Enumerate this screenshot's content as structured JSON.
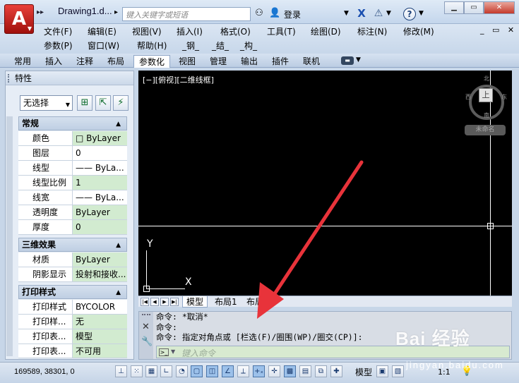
{
  "titlebar": {
    "app_logo": "A",
    "document_title": "Drawing1.d...",
    "search_placeholder": "键入关键字或短语",
    "login_label": "登录",
    "icons": [
      "binoculars-icon",
      "user-icon",
      "exchange-x-icon",
      "a360-icon",
      "help-icon"
    ]
  },
  "menu": {
    "row1": [
      "文件(F)",
      "编辑(E)",
      "视图(V)",
      "插入(I)",
      "格式(O)",
      "工具(T)",
      "绘图(D)",
      "标注(N)",
      "修改(M)"
    ],
    "row2": [
      "参数(P)",
      "窗口(W)",
      "帮助(H)",
      "_钢_",
      "_结_",
      "_构_"
    ]
  },
  "ribbon": {
    "tabs": [
      "常用",
      "插入",
      "注释",
      "布局",
      "参数化",
      "视图",
      "管理",
      "输出",
      "插件",
      "联机"
    ],
    "active_tab": "参数化"
  },
  "properties": {
    "title": "特性",
    "selection": "无选择",
    "sections": [
      {
        "title": "常规",
        "rows": [
          [
            "颜色",
            "□ ByLayer"
          ],
          [
            "图层",
            "0"
          ],
          [
            "线型",
            "—— ByLa..."
          ],
          [
            "线型比例",
            "1"
          ],
          [
            "线宽",
            "—— ByLa..."
          ],
          [
            "透明度",
            "ByLayer"
          ],
          [
            "厚度",
            "0"
          ]
        ]
      },
      {
        "title": "三维效果",
        "rows": [
          [
            "材质",
            "ByLayer"
          ],
          [
            "阴影显示",
            "投射和接收..."
          ]
        ]
      },
      {
        "title": "打印样式",
        "rows": [
          [
            "打印样式",
            "BYCOLOR"
          ],
          [
            "打印样...",
            "无"
          ],
          [
            "打印表...",
            "模型"
          ],
          [
            "打印表...",
            "不可用"
          ]
        ]
      }
    ]
  },
  "canvas": {
    "viewport_label": "[−][俯视][二维线框]",
    "compass": {
      "north": "北",
      "south": "南",
      "east": "东",
      "west": "西",
      "top_face": "上"
    },
    "wcs_label": "未命名",
    "axis_y": "Y",
    "axis_x": "X"
  },
  "layout_tabs": [
    "模型",
    "布局1",
    "布局2"
  ],
  "command": {
    "history": [
      "命令: *取消*",
      "命令:",
      "命令: 指定对角点或 [栏选(F)/圈围(WP)/圈交(CP)]:"
    ],
    "input_placeholder": "键入命令"
  },
  "status": {
    "coords": "169589, 38301, 0",
    "model_label": "模型",
    "annotation_scale": "1:1"
  },
  "watermark": {
    "text": "Bai 经验",
    "subtext": "jingyan.baidu.com"
  },
  "colors": {
    "canvas": "#000000",
    "arrow": "#e8333a",
    "property_value_bg": "#d2ebd0",
    "ribbon_active": "#ffffff"
  }
}
